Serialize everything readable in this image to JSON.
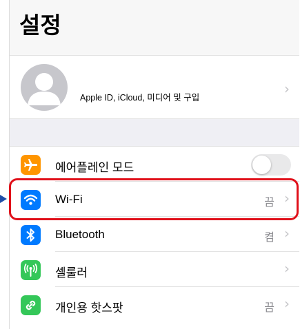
{
  "header": {
    "title": "설정"
  },
  "profile": {
    "label": "Apple ID, iCloud, 미디어 및 구입"
  },
  "rows": [
    {
      "label": "에어플레인 모드",
      "icon": "airplane-icon",
      "icon_color": "#ff9500",
      "toggle": "off"
    },
    {
      "label": "Wi-Fi",
      "value": "끔",
      "icon": "wifi-icon",
      "icon_color": "#007aff"
    },
    {
      "label": "Bluetooth",
      "value": "켬",
      "icon": "bluetooth-icon",
      "icon_color": "#007aff"
    },
    {
      "label": "셀룰러",
      "icon": "cellular-icon",
      "icon_color": "#34c759"
    },
    {
      "label": "개인용 핫스팟",
      "value": "끔",
      "icon": "hotspot-icon",
      "icon_color": "#34c759"
    }
  ],
  "annotation": {
    "highlight_color": "#e0101a",
    "arrow_color": "#1f4ea8"
  }
}
